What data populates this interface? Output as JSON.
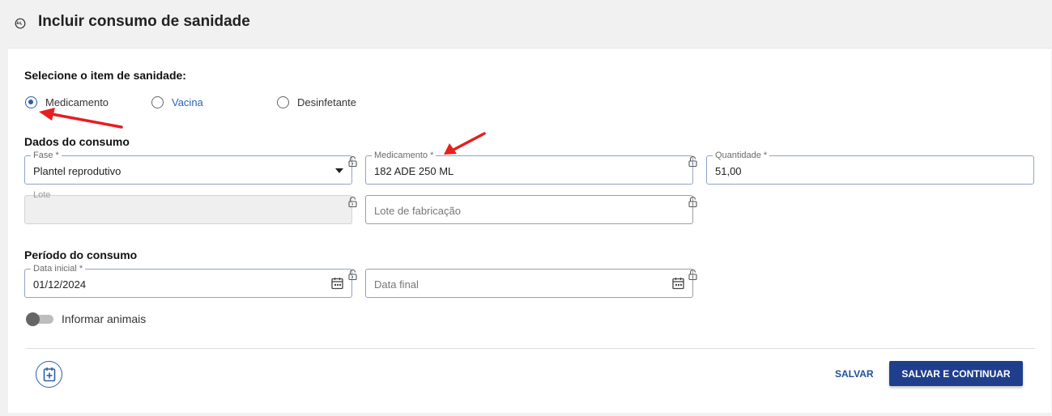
{
  "header": {
    "title": "Incluir consumo de sanidade",
    "back_icon": "history-back-icon"
  },
  "item_section": {
    "title": "Selecione o item de sanidade:",
    "options": [
      {
        "label": "Medicamento",
        "selected": true
      },
      {
        "label": "Vacina",
        "selected": false
      },
      {
        "label": "Desinfetante",
        "selected": false
      }
    ]
  },
  "consumo_section": {
    "title": "Dados do consumo",
    "fase": {
      "legend": "Fase *",
      "value": "Plantel reprodutivo"
    },
    "medicamento": {
      "legend": "Medicamento *",
      "value": "182 ADE 250 ML"
    },
    "quantidade": {
      "legend": "Quantidade *",
      "value": "51,00"
    },
    "lote": {
      "legend": "Lote",
      "value": ""
    },
    "lote_fabricacao": {
      "placeholder": "Lote de fabricação"
    }
  },
  "periodo_section": {
    "title": "Período do consumo",
    "data_inicial": {
      "legend": "Data inicial *",
      "value": "01/12/2024"
    },
    "data_final": {
      "placeholder": "Data final"
    }
  },
  "toggle": {
    "label": "Informar animais",
    "on": false
  },
  "actions": {
    "save_label": "SALVAR",
    "save_continue_label": "SALVAR E CONTINUAR"
  },
  "colors": {
    "accent": "#2b5fa6",
    "primary_button": "#1f3f8c",
    "annotation_arrow": "#e81e1e"
  }
}
